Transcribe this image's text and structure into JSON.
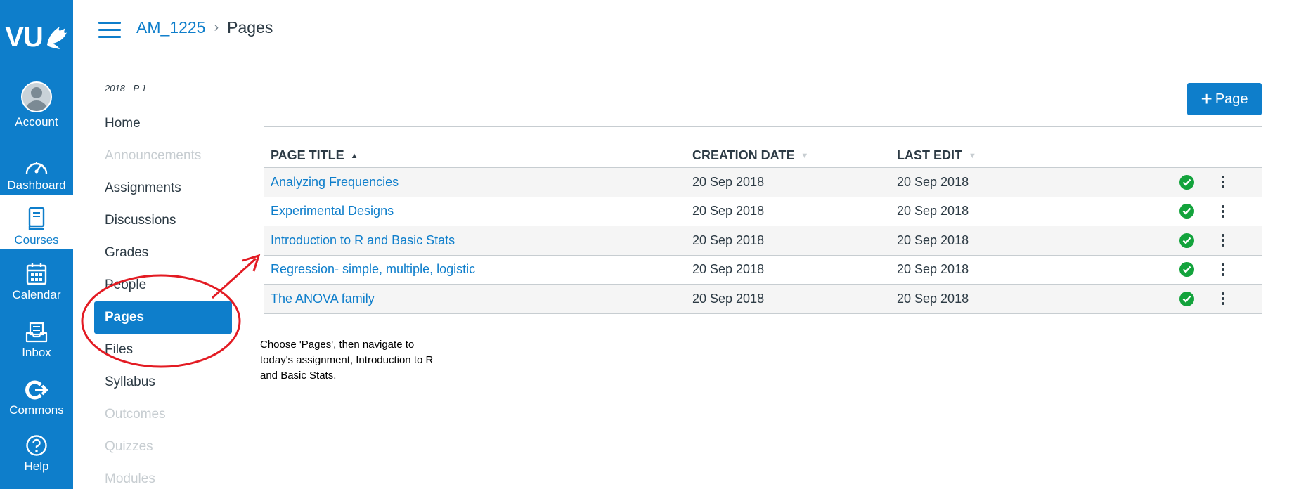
{
  "global_nav": {
    "logo_text": "VU",
    "items": [
      {
        "label": "Account",
        "icon": "avatar-icon"
      },
      {
        "label": "Dashboard",
        "icon": "dashboard-icon"
      },
      {
        "label": "Courses",
        "icon": "courses-icon",
        "active": true
      },
      {
        "label": "Calendar",
        "icon": "calendar-icon"
      },
      {
        "label": "Inbox",
        "icon": "inbox-icon"
      },
      {
        "label": "Commons",
        "icon": "commons-icon"
      },
      {
        "label": "Help",
        "icon": "help-icon"
      }
    ]
  },
  "header": {
    "breadcrumb_course": "AM_1225",
    "breadcrumb_separator": "›",
    "breadcrumb_current": "Pages"
  },
  "course_nav": {
    "term": "2018 - P 1",
    "items": [
      {
        "label": "Home",
        "state": "normal"
      },
      {
        "label": "Announcements",
        "state": "disabled"
      },
      {
        "label": "Assignments",
        "state": "normal"
      },
      {
        "label": "Discussions",
        "state": "normal"
      },
      {
        "label": "Grades",
        "state": "normal"
      },
      {
        "label": "People",
        "state": "normal"
      },
      {
        "label": "Pages",
        "state": "active"
      },
      {
        "label": "Files",
        "state": "normal"
      },
      {
        "label": "Syllabus",
        "state": "normal"
      },
      {
        "label": "Outcomes",
        "state": "disabled"
      },
      {
        "label": "Quizzes",
        "state": "disabled"
      },
      {
        "label": "Modules",
        "state": "disabled"
      }
    ]
  },
  "main": {
    "add_page_label": "Page",
    "add_page_plus": "+",
    "columns": {
      "title": "PAGE TITLE",
      "created": "CREATION DATE",
      "last_edit": "LAST EDIT"
    },
    "sort_indicators": {
      "active": "▲",
      "inactive": "▼"
    },
    "rows": [
      {
        "title": "Analyzing Frequencies",
        "created": "20 Sep 2018",
        "last_edit": "20 Sep 2018"
      },
      {
        "title": "Experimental Designs",
        "created": "20 Sep 2018",
        "last_edit": "20 Sep 2018"
      },
      {
        "title": "Introduction to R and Basic Stats",
        "created": "20 Sep 2018",
        "last_edit": "20 Sep 2018"
      },
      {
        "title": "Regression- simple, multiple, logistic",
        "created": "20 Sep 2018",
        "last_edit": "20 Sep 2018"
      },
      {
        "title": "The ANOVA family",
        "created": "20 Sep 2018",
        "last_edit": "20 Sep 2018"
      }
    ]
  },
  "annotation": {
    "line1": "Choose 'Pages', then navigate to",
    "line2": "today's assignment, Introduction to R",
    "line3": "and Basic Stats.",
    "color": "#e31b23"
  },
  "colors": {
    "brand": "#0e7ecb",
    "published": "#13a33c"
  }
}
